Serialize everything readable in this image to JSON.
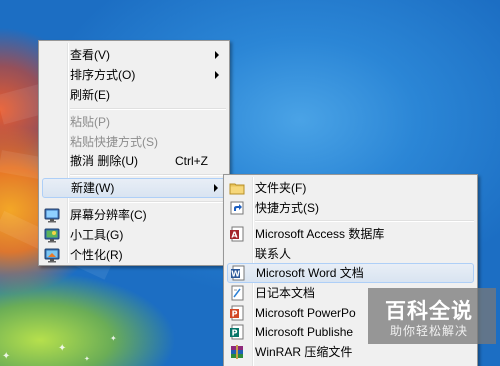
{
  "desktop": {
    "accent_blue": "#1c72c9",
    "highlight_border": "#aecff7"
  },
  "context_menu": {
    "items": [
      {
        "label": "查看(V)",
        "submenu": true
      },
      {
        "label": "排序方式(O)",
        "submenu": true
      },
      {
        "label": "刷新(E)"
      },
      {
        "label": "粘贴(P)",
        "disabled": true
      },
      {
        "label": "粘贴快捷方式(S)",
        "disabled": true
      },
      {
        "label": "撤消 删除(U)",
        "shortcut": "Ctrl+Z"
      },
      {
        "label": "新建(W)",
        "submenu": true,
        "highlighted": true
      },
      {
        "label": "屏幕分辨率(C)",
        "icon": "display-icon"
      },
      {
        "label": "小工具(G)",
        "icon": "gadgets-icon"
      },
      {
        "label": "个性化(R)",
        "icon": "personalize-icon"
      }
    ]
  },
  "new_submenu": {
    "items": [
      {
        "label": "文件夹(F)",
        "icon": "folder-icon"
      },
      {
        "label": "快捷方式(S)",
        "icon": "shortcut-icon"
      },
      {
        "label": "Microsoft Access 数据库",
        "icon": "access-icon"
      },
      {
        "label": "联系人",
        "icon": "contact-icon"
      },
      {
        "label": "Microsoft Word 文档",
        "icon": "word-icon",
        "highlighted": true
      },
      {
        "label": "日记本文档",
        "icon": "journal-icon"
      },
      {
        "label": "Microsoft PowerPo",
        "icon": "powerpoint-icon"
      },
      {
        "label": "Microsoft Publishe",
        "icon": "publisher-icon"
      },
      {
        "label": "WinRAR 压缩文件",
        "icon": "winrar-icon"
      }
    ]
  },
  "watermark": {
    "logo": "百科全说",
    "subtitle": "助你轻松解决"
  }
}
